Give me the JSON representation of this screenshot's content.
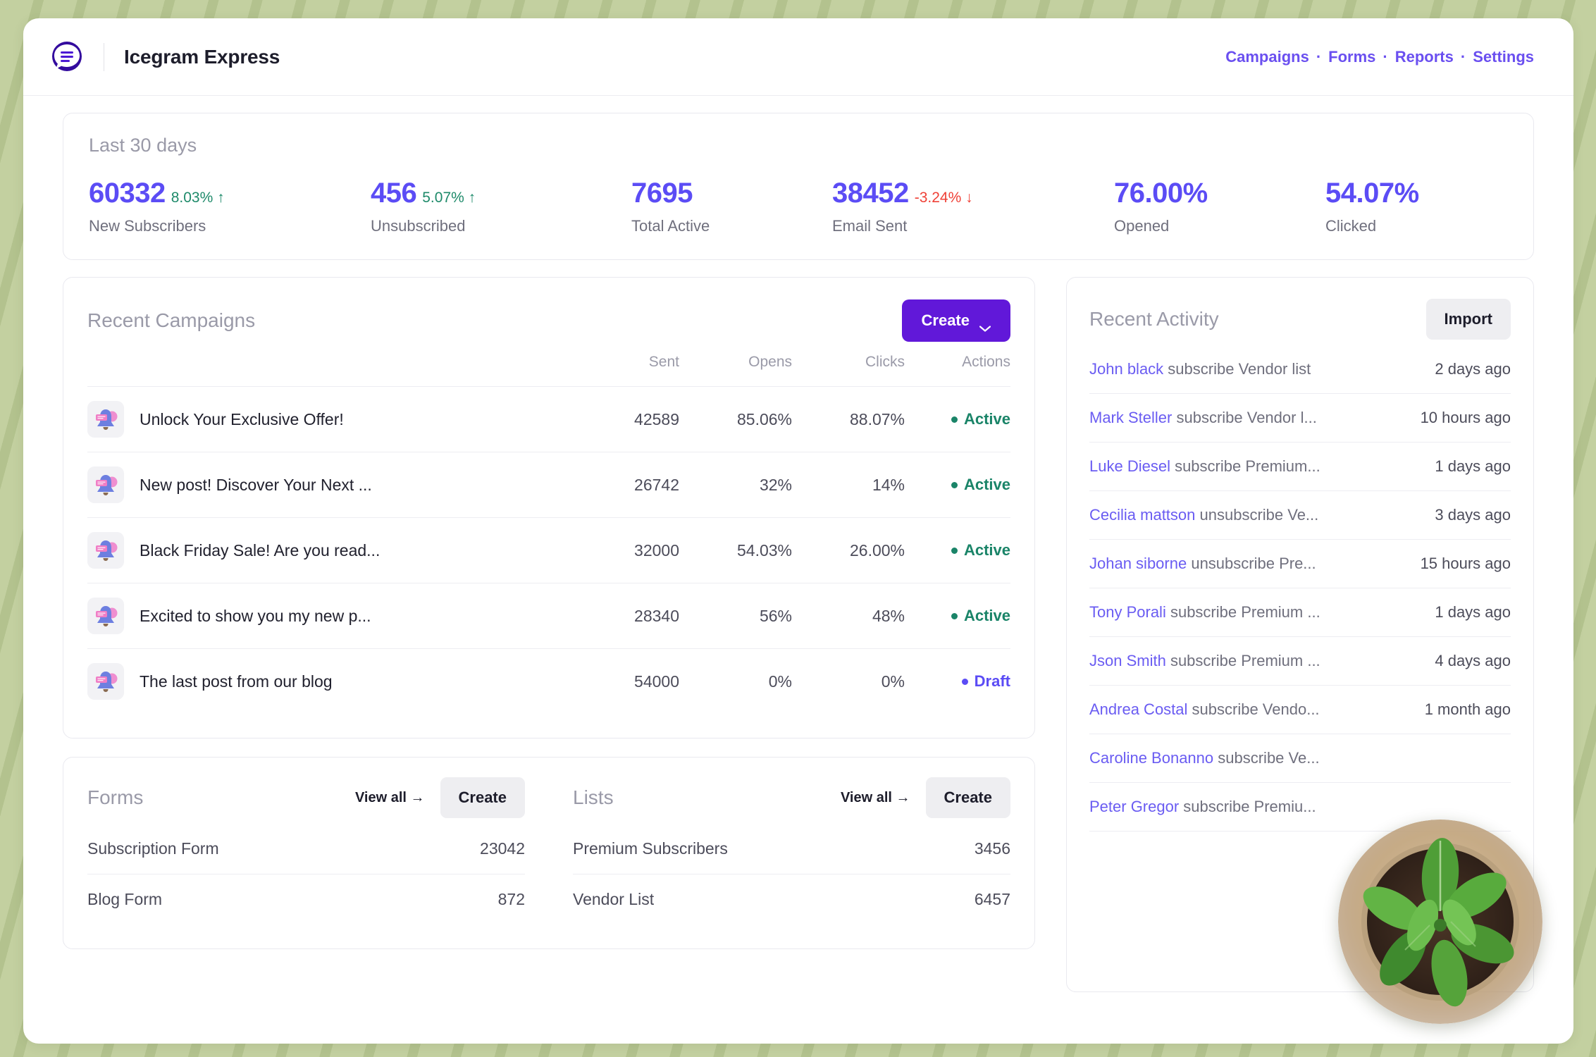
{
  "header": {
    "logo_icon": "speech-bubble-lines-icon",
    "app_title": "Icegram Express",
    "nav": [
      {
        "label": "Campaigns"
      },
      {
        "label": "Forms"
      },
      {
        "label": "Reports"
      },
      {
        "label": "Settings"
      }
    ],
    "nav_separator": "·"
  },
  "colors": {
    "brand_purple": "#6118d9",
    "accent_violet": "#5b4cf5",
    "link_violet": "#6a4ff0",
    "status_active": "#1a8468",
    "status_draft": "#5b4cf5",
    "delta_up": "#1e8a6a",
    "delta_down": "#ef4137",
    "page_background": "#c3d0a0"
  },
  "stats": {
    "title": "Last 30 days",
    "items": [
      {
        "value": "60332",
        "delta": "8.03%",
        "delta_dir": "up",
        "delta_arrow": "↑",
        "label": "New Subscribers"
      },
      {
        "value": "456",
        "delta": "5.07%",
        "delta_dir": "up",
        "delta_arrow": "↑",
        "label": "Unsubscribed"
      },
      {
        "value": "7695",
        "delta": "",
        "delta_dir": "none",
        "delta_arrow": "",
        "label": "Total Active"
      },
      {
        "value": "38452",
        "delta": "-3.24%",
        "delta_dir": "down",
        "delta_arrow": "↓",
        "label": "Email Sent"
      },
      {
        "value": "76.00%",
        "delta": "",
        "delta_dir": "none",
        "delta_arrow": "",
        "label": "Opened"
      },
      {
        "value": "54.07%",
        "delta": "",
        "delta_dir": "none",
        "delta_arrow": "",
        "label": "Clicked"
      }
    ]
  },
  "campaigns": {
    "title": "Recent Campaigns",
    "create_label": "Create",
    "create_icon": "chevron-down-icon",
    "columns": {
      "name": "",
      "sent": "Sent",
      "opens": "Opens",
      "clicks": "Clicks",
      "actions": "Actions"
    },
    "rows": [
      {
        "icon": "bell-notification-icon",
        "name": "Unlock Your Exclusive Offer!",
        "sent": "42589",
        "opens": "85.06%",
        "clicks": "88.07%",
        "status": "Active",
        "status_kind": "active"
      },
      {
        "icon": "bell-notification-icon",
        "name": "New post! Discover Your Next ...",
        "sent": "26742",
        "opens": "32%",
        "clicks": "14%",
        "status": "Active",
        "status_kind": "active"
      },
      {
        "icon": "bell-notification-icon",
        "name": "Black Friday Sale! Are you read...",
        "sent": "32000",
        "opens": "54.03%",
        "clicks": "26.00%",
        "status": "Active",
        "status_kind": "active"
      },
      {
        "icon": "bell-notification-icon",
        "name": "Excited to show you my new p...",
        "sent": "28340",
        "opens": "56%",
        "clicks": "48%",
        "status": "Active",
        "status_kind": "active"
      },
      {
        "icon": "bell-notification-icon",
        "name": "The last post from our blog",
        "sent": "54000",
        "opens": "0%",
        "clicks": "0%",
        "status": "Draft",
        "status_kind": "draft"
      }
    ]
  },
  "forms": {
    "title": "Forms",
    "view_all_label": "View all →",
    "create_label": "Create",
    "rows": [
      {
        "name": "Subscription Form",
        "value": "23042"
      },
      {
        "name": "Blog Form",
        "value": "872"
      }
    ]
  },
  "lists": {
    "title": "Lists",
    "view_all_label": "View all →",
    "create_label": "Create",
    "rows": [
      {
        "name": "Premium Subscribers",
        "value": "3456"
      },
      {
        "name": "Vendor List",
        "value": "6457"
      }
    ]
  },
  "activity": {
    "title": "Recent Activity",
    "import_label": "Import",
    "rows": [
      {
        "user": "John black",
        "action": " subscribe Vendor list",
        "time": "2 days ago"
      },
      {
        "user": "Mark Steller",
        "action": " subscribe Vendor l...",
        "time": "10 hours ago"
      },
      {
        "user": "Luke Diesel",
        "action": " subscribe Premium...",
        "time": "1 days ago"
      },
      {
        "user": "Cecilia mattson",
        "action": " unsubscribe Ve...",
        "time": "3 days ago"
      },
      {
        "user": "Johan siborne",
        "action": " unsubscribe Pre...",
        "time": "15 hours ago"
      },
      {
        "user": "Tony Porali",
        "action": " subscribe Premium ...",
        "time": "1 days ago"
      },
      {
        "user": "Json Smith",
        "action": " subscribe Premium ...",
        "time": "4 days ago"
      },
      {
        "user": "Andrea Costal",
        "action": " subscribe Vendo...",
        "time": "1 month ago"
      },
      {
        "user": "Caroline Bonanno",
        "action": " subscribe Ve...",
        "time": ""
      },
      {
        "user": "Peter Gregor",
        "action": " subscribe Premiu...",
        "time": ""
      }
    ]
  },
  "decoration": {
    "plant_image": "potted-plant-photo"
  }
}
